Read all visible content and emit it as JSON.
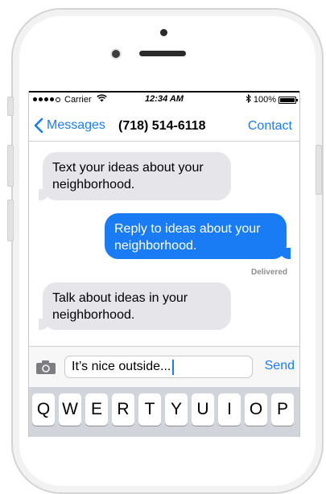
{
  "status_bar": {
    "carrier": "Carrier",
    "time": "12:34 AM",
    "battery": "100%",
    "wifi_icon": "wifi-icon",
    "bluetooth_icon": "bluetooth-icon"
  },
  "nav": {
    "back_label": "Messages",
    "title": "(718) 514-6118",
    "contact_label": "Contact"
  },
  "messages": [
    {
      "direction": "incoming",
      "text": "Text your ideas about your neighborhood."
    },
    {
      "direction": "outgoing",
      "text": "Reply to ideas about your neighborhood."
    },
    {
      "direction": "incoming",
      "text": "Talk about ideas in your neighborhood."
    }
  ],
  "delivered_label": "Delivered",
  "composer": {
    "value": "It’s nice outside...",
    "send_label": "Send",
    "camera_icon": "camera-icon"
  },
  "keyboard": {
    "row1": [
      "Q",
      "W",
      "E",
      "R",
      "T",
      "Y",
      "U",
      "I",
      "O",
      "P"
    ]
  },
  "colors": {
    "accent": "#1a7cf5",
    "incoming_bubble": "#e5e5ea",
    "keyboard_bg": "#d1d5db"
  }
}
